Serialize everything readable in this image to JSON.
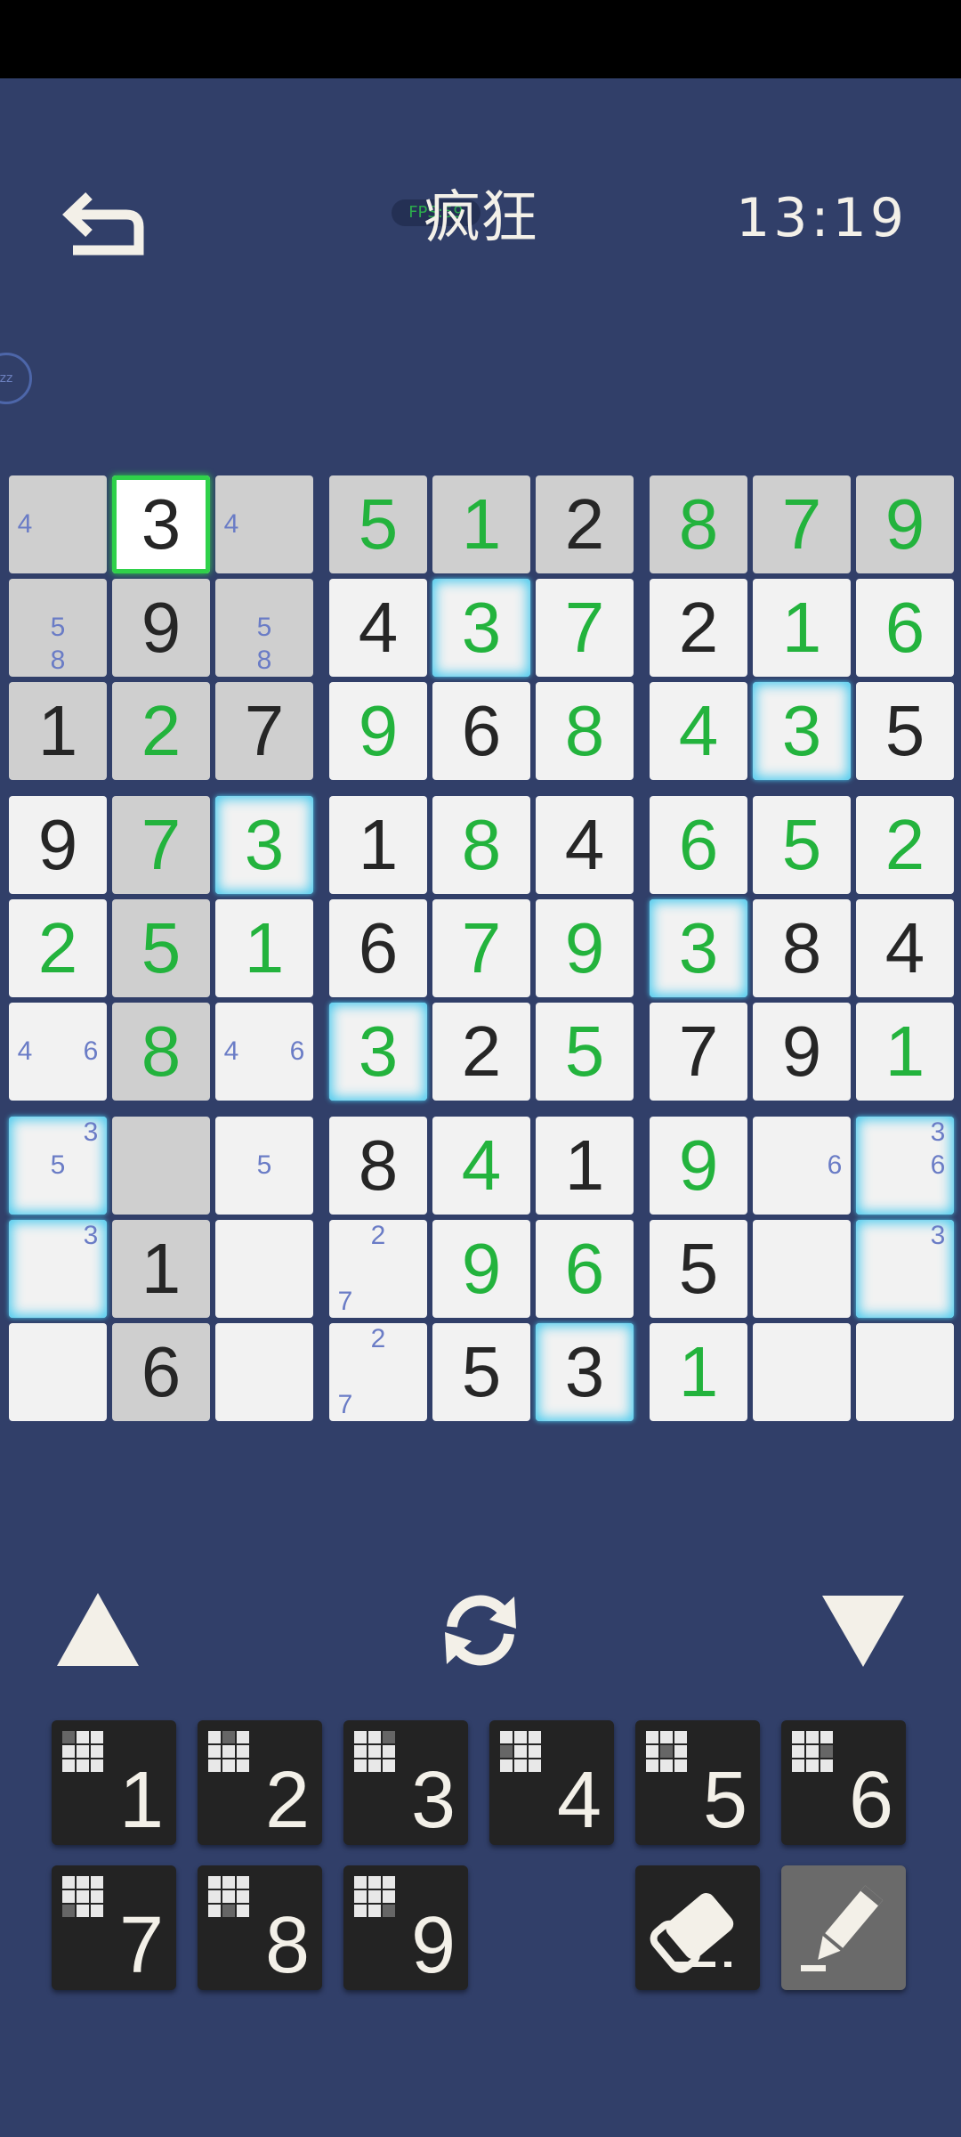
{
  "header": {
    "title": "疯狂",
    "badge": "FPS:59",
    "timer": "13:19",
    "side_badge": "zz"
  },
  "colors": {
    "background": "#313f69",
    "given_cell": "#cfcfcf",
    "open_cell": "#f2f2f2",
    "user_digit": "#23b33d",
    "fixed_digit": "#262626",
    "note": "#6a7cc6",
    "selection": "#2fd14a",
    "highlight": "#45c9ee"
  },
  "board": {
    "rows": [
      [
        {
          "b": "g",
          "n": [
            4
          ]
        },
        {
          "v": "3",
          "s": "f",
          "b": "sel"
        },
        {
          "b": "g",
          "n": [
            4
          ]
        },
        {
          "v": "5",
          "s": "u",
          "b": "g"
        },
        {
          "v": "1",
          "s": "u",
          "b": "g"
        },
        {
          "v": "2",
          "s": "f",
          "b": "g"
        },
        {
          "v": "8",
          "s": "u",
          "b": "g"
        },
        {
          "v": "7",
          "s": "u",
          "b": "g"
        },
        {
          "v": "9",
          "s": "u",
          "b": "g"
        }
      ],
      [
        {
          "b": "g",
          "n": [
            5,
            8
          ]
        },
        {
          "v": "9",
          "s": "f",
          "b": "g"
        },
        {
          "b": "g",
          "n": [
            5,
            8
          ]
        },
        {
          "v": "4",
          "s": "f",
          "b": "w"
        },
        {
          "v": "3",
          "s": "u",
          "b": "w",
          "h": true
        },
        {
          "v": "7",
          "s": "u",
          "b": "w"
        },
        {
          "v": "2",
          "s": "f",
          "b": "w"
        },
        {
          "v": "1",
          "s": "u",
          "b": "w"
        },
        {
          "v": "6",
          "s": "u",
          "b": "w"
        }
      ],
      [
        {
          "v": "1",
          "s": "f",
          "b": "g"
        },
        {
          "v": "2",
          "s": "u",
          "b": "g"
        },
        {
          "v": "7",
          "s": "f",
          "b": "g"
        },
        {
          "v": "9",
          "s": "u",
          "b": "w"
        },
        {
          "v": "6",
          "s": "f",
          "b": "w"
        },
        {
          "v": "8",
          "s": "u",
          "b": "w"
        },
        {
          "v": "4",
          "s": "u",
          "b": "w"
        },
        {
          "v": "3",
          "s": "u",
          "b": "w",
          "h": true
        },
        {
          "v": "5",
          "s": "f",
          "b": "w"
        }
      ],
      [
        {
          "v": "9",
          "s": "f",
          "b": "w"
        },
        {
          "v": "7",
          "s": "u",
          "b": "g"
        },
        {
          "v": "3",
          "s": "u",
          "b": "w",
          "h": true
        },
        {
          "v": "1",
          "s": "f",
          "b": "w"
        },
        {
          "v": "8",
          "s": "u",
          "b": "w"
        },
        {
          "v": "4",
          "s": "f",
          "b": "w"
        },
        {
          "v": "6",
          "s": "u",
          "b": "w"
        },
        {
          "v": "5",
          "s": "u",
          "b": "w"
        },
        {
          "v": "2",
          "s": "u",
          "b": "w"
        }
      ],
      [
        {
          "v": "2",
          "s": "u",
          "b": "w"
        },
        {
          "v": "5",
          "s": "u",
          "b": "g"
        },
        {
          "v": "1",
          "s": "u",
          "b": "w"
        },
        {
          "v": "6",
          "s": "f",
          "b": "w"
        },
        {
          "v": "7",
          "s": "u",
          "b": "w"
        },
        {
          "v": "9",
          "s": "u",
          "b": "w"
        },
        {
          "v": "3",
          "s": "u",
          "b": "w",
          "h": true
        },
        {
          "v": "8",
          "s": "f",
          "b": "w"
        },
        {
          "v": "4",
          "s": "f",
          "b": "w"
        }
      ],
      [
        {
          "b": "w",
          "n": [
            4,
            6
          ]
        },
        {
          "v": "8",
          "s": "u",
          "b": "g"
        },
        {
          "b": "w",
          "n": [
            4,
            6
          ]
        },
        {
          "v": "3",
          "s": "u",
          "b": "w",
          "h": true
        },
        {
          "v": "2",
          "s": "f",
          "b": "w"
        },
        {
          "v": "5",
          "s": "u",
          "b": "w"
        },
        {
          "v": "7",
          "s": "f",
          "b": "w"
        },
        {
          "v": "9",
          "s": "f",
          "b": "w"
        },
        {
          "v": "1",
          "s": "u",
          "b": "w"
        }
      ],
      [
        {
          "b": "w",
          "h": true,
          "n": [
            3,
            5
          ]
        },
        {
          "b": "g"
        },
        {
          "b": "w",
          "n": [
            5
          ]
        },
        {
          "v": "8",
          "s": "f",
          "b": "w"
        },
        {
          "v": "4",
          "s": "u",
          "b": "w"
        },
        {
          "v": "1",
          "s": "f",
          "b": "w"
        },
        {
          "v": "9",
          "s": "u",
          "b": "w"
        },
        {
          "b": "w",
          "n": [
            6
          ]
        },
        {
          "b": "w",
          "h": true,
          "n": [
            3,
            6
          ]
        }
      ],
      [
        {
          "b": "w",
          "h": true,
          "n": [
            3
          ]
        },
        {
          "v": "1",
          "s": "f",
          "b": "g"
        },
        {
          "b": "w"
        },
        {
          "b": "w",
          "n": [
            2,
            7
          ]
        },
        {
          "v": "9",
          "s": "u",
          "b": "w"
        },
        {
          "v": "6",
          "s": "u",
          "b": "w"
        },
        {
          "v": "5",
          "s": "f",
          "b": "w"
        },
        {
          "b": "w"
        },
        {
          "b": "w",
          "h": true,
          "n": [
            3
          ]
        }
      ],
      [
        {
          "b": "w"
        },
        {
          "v": "6",
          "s": "f",
          "b": "g"
        },
        {
          "b": "w"
        },
        {
          "b": "w",
          "n": [
            2,
            7
          ]
        },
        {
          "v": "5",
          "s": "f",
          "b": "w"
        },
        {
          "v": "3",
          "s": "f",
          "b": "w",
          "h": true
        },
        {
          "v": "1",
          "s": "u",
          "b": "w"
        },
        {
          "b": "w"
        },
        {
          "b": "w"
        }
      ]
    ]
  },
  "controls": {
    "prev_icon": "triangle-up-icon",
    "refresh_icon": "refresh-icon",
    "next_icon": "triangle-down-icon"
  },
  "numpad": {
    "digits": [
      "1",
      "2",
      "3",
      "4",
      "5",
      "6",
      "7",
      "8",
      "9"
    ],
    "eraser_icon": "eraser-icon",
    "pencil_icon": "pencil-icon"
  }
}
